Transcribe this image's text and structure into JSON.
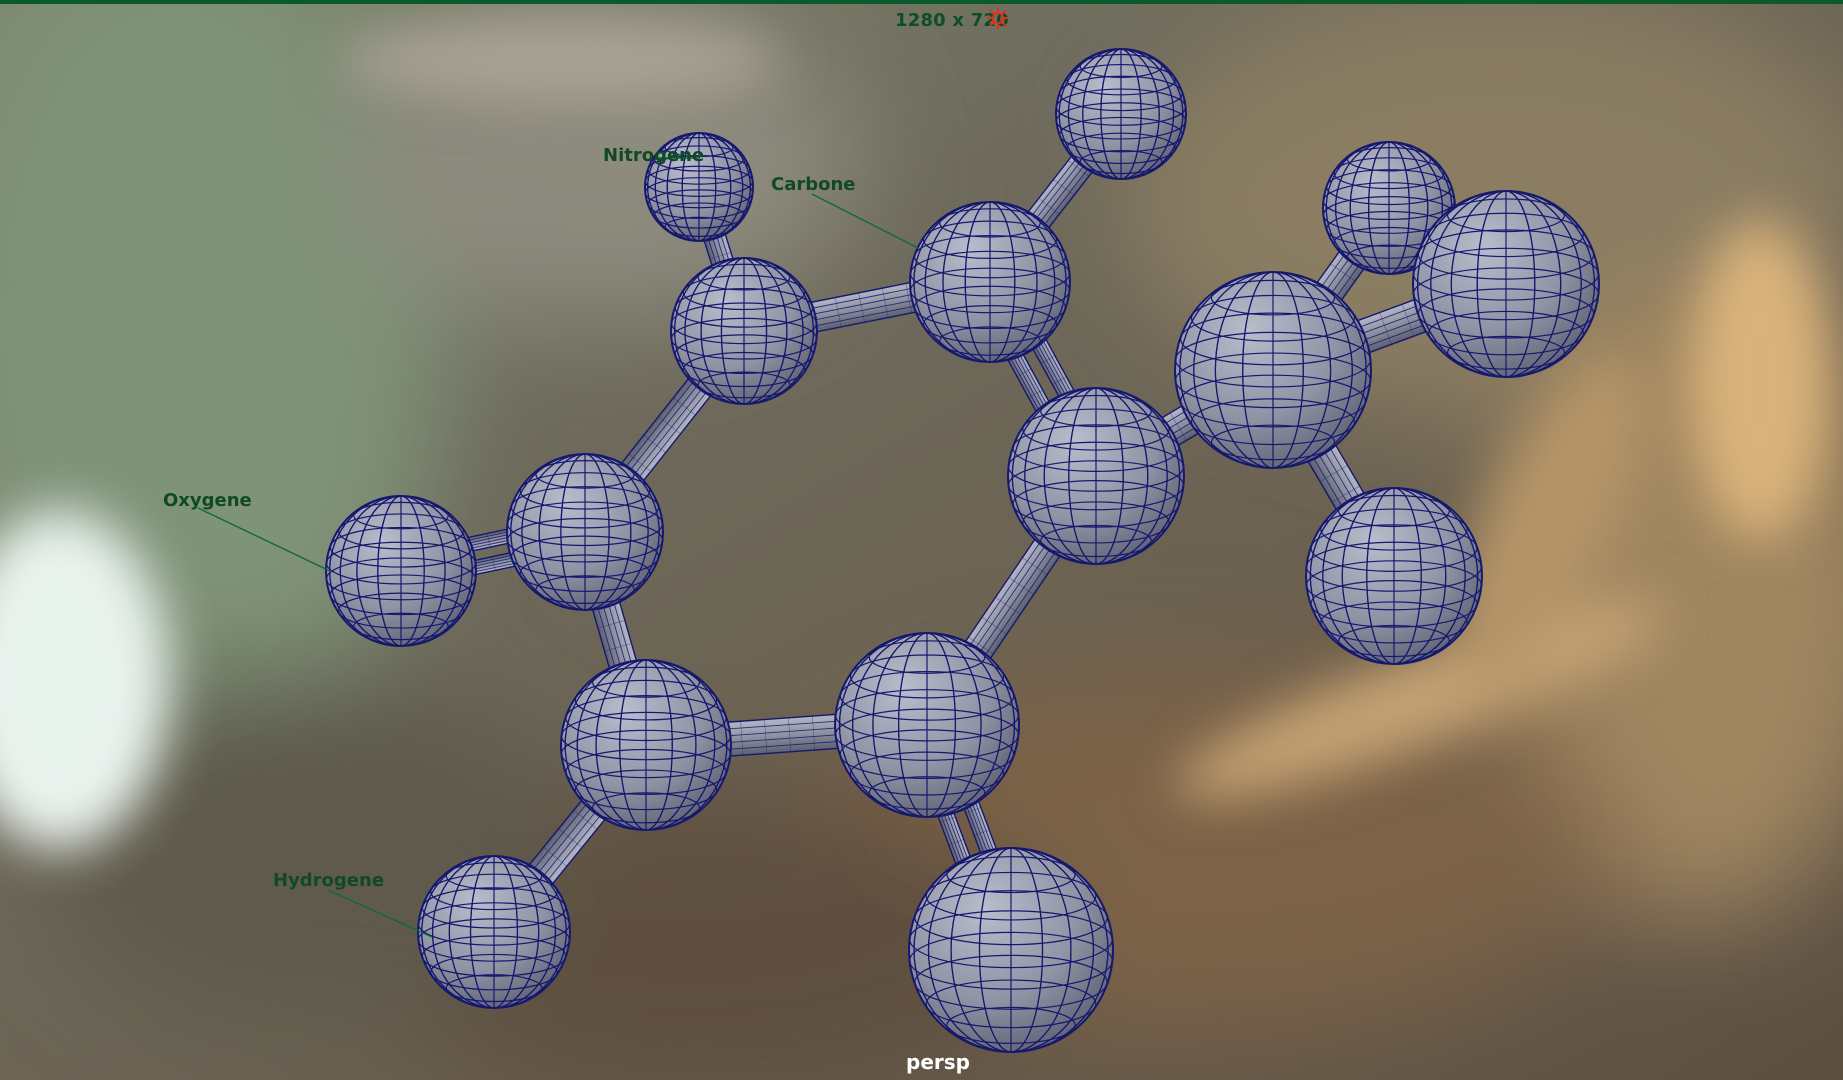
{
  "viewport": {
    "resolution_gate": "1280 x 720",
    "camera": "persp",
    "gate_icon": "resolution-gate-icon"
  },
  "annotations": {
    "nitrogene": "Nitrogene",
    "carbone": "Carbone",
    "oxygene": "Oxygene",
    "hydrogene": "Hydrogene"
  },
  "colors": {
    "wireframe": "#16186e",
    "atom_fill": "#8f93a3",
    "annotation_text": "#0f4a23",
    "top_border": "#0b5a2a",
    "camera_label": "#ffffff"
  }
}
